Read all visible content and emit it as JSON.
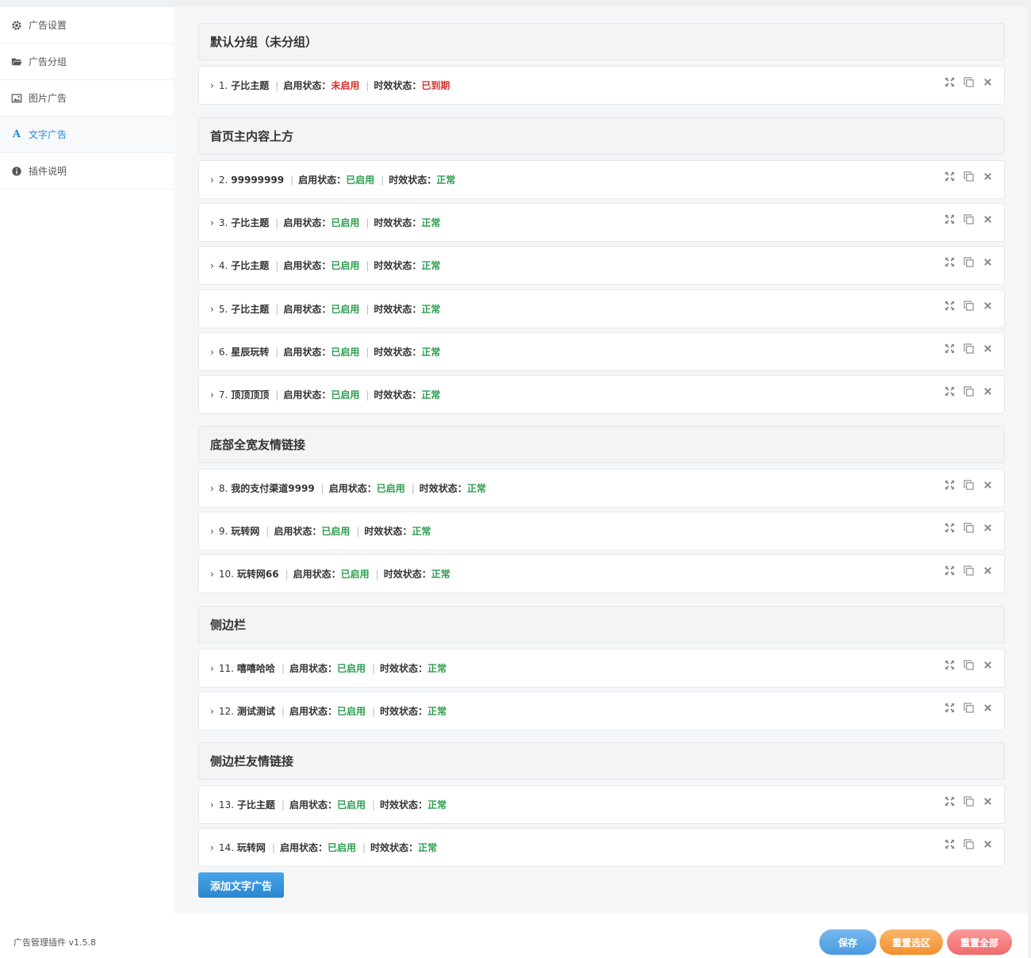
{
  "sidebar": {
    "items": [
      {
        "label": "广告设置",
        "icon": "gear-icon",
        "active": false
      },
      {
        "label": "广告分组",
        "icon": "folder-open-icon",
        "active": false
      },
      {
        "label": "图片广告",
        "icon": "image-icon",
        "active": false
      },
      {
        "label": "文字广告",
        "icon": "text-a-icon",
        "active": true
      },
      {
        "label": "插件说明",
        "icon": "info-circle-icon",
        "active": false
      }
    ]
  },
  "labels": {
    "enable_status": "启用状态：",
    "time_status": "时效状态：",
    "separator": "|",
    "chevron": "›"
  },
  "colors": {
    "green": "#2e9e4f",
    "red": "#d6312f",
    "accent": "#2a8ad4"
  },
  "groups": [
    {
      "title": "默认分组（未分组）",
      "ads": [
        {
          "num": "1.",
          "title": "子比主题",
          "enabled": "未启用",
          "timing": "已到期",
          "state": "bad"
        }
      ]
    },
    {
      "title": "首页主内容上方",
      "ads": [
        {
          "num": "2.",
          "title": "99999999",
          "enabled": "已启用",
          "timing": "正常",
          "state": "ok"
        },
        {
          "num": "3.",
          "title": "子比主题",
          "enabled": "已启用",
          "timing": "正常",
          "state": "ok"
        },
        {
          "num": "4.",
          "title": "子比主题",
          "enabled": "已启用",
          "timing": "正常",
          "state": "ok"
        },
        {
          "num": "5.",
          "title": "子比主题",
          "enabled": "已启用",
          "timing": "正常",
          "state": "ok"
        },
        {
          "num": "6.",
          "title": "星辰玩转",
          "enabled": "已启用",
          "timing": "正常",
          "state": "ok"
        },
        {
          "num": "7.",
          "title": "顶顶顶顶",
          "enabled": "已启用",
          "timing": "正常",
          "state": "ok"
        }
      ]
    },
    {
      "title": "底部全宽友情链接",
      "ads": [
        {
          "num": "8.",
          "title": "我的支付渠道9999",
          "enabled": "已启用",
          "timing": "正常",
          "state": "ok"
        },
        {
          "num": "9.",
          "title": "玩转网",
          "enabled": "已启用",
          "timing": "正常",
          "state": "ok"
        },
        {
          "num": "10.",
          "title": "玩转网66",
          "enabled": "已启用",
          "timing": "正常",
          "state": "ok"
        }
      ]
    },
    {
      "title": "侧边栏",
      "ads": [
        {
          "num": "11.",
          "title": "嘻嘻哈哈",
          "enabled": "已启用",
          "timing": "正常",
          "state": "ok"
        },
        {
          "num": "12.",
          "title": "测试测试",
          "enabled": "已启用",
          "timing": "正常",
          "state": "ok"
        }
      ]
    },
    {
      "title": "侧边栏友情链接",
      "ads": [
        {
          "num": "13.",
          "title": "子比主题",
          "enabled": "已启用",
          "timing": "正常",
          "state": "ok"
        },
        {
          "num": "14.",
          "title": "玩转网",
          "enabled": "已启用",
          "timing": "正常",
          "state": "ok"
        }
      ]
    }
  ],
  "add_button": "添加文字广告",
  "footer": {
    "version": "广告管理插件 v1.5.8",
    "save": "保存",
    "reset_selection": "重置选区",
    "reset_all": "重置全部"
  }
}
